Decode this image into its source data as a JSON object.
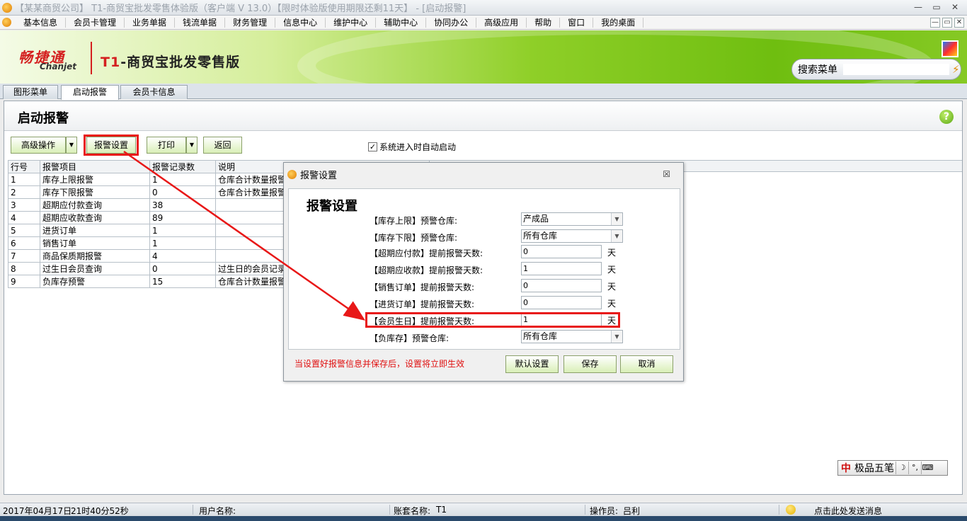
{
  "window": {
    "title": "【某某商贸公司】 T1-商贸宝批发零售体验版（客户端 V 13.0）【限时体验版使用期限还剩11天】 - [启动报警]",
    "controls": [
      "—",
      "▭",
      "✕"
    ]
  },
  "menu": {
    "items": [
      "基本信息",
      "会员卡管理",
      "业务单据",
      "钱流单据",
      "财务管理",
      "信息中心",
      "维护中心",
      "辅助中心",
      "协同办公",
      "高级应用",
      "帮助",
      "窗口",
      "我的桌面"
    ],
    "mdi_controls": [
      "—",
      "▭",
      "✕"
    ]
  },
  "banner": {
    "logo_cn": "畅捷通",
    "logo_en": "Chanjet",
    "product_t1": "T1",
    "product_name": "-商贸宝批发零售版",
    "search_label": "搜索菜单",
    "search_value": ""
  },
  "tabs": [
    "图形菜单",
    "启动报警",
    "会员卡信息"
  ],
  "page": {
    "title": "启动报警",
    "help": "?"
  },
  "toolbar": {
    "advanced": "高级操作",
    "alarm_settings": "报警设置",
    "print": "打印",
    "back": "返回",
    "auto_start_label": "系统进入时自动启动",
    "auto_start_checked": "✓"
  },
  "grid": {
    "headers": [
      "行号",
      "报警项目",
      "报警记录数",
      "说明"
    ],
    "rows": [
      [
        "1",
        "库存上限报警",
        "1",
        "仓库合计数量报警"
      ],
      [
        "2",
        "库存下限报警",
        "0",
        "仓库合计数量报警"
      ],
      [
        "3",
        "超期应付款查询",
        "38",
        ""
      ],
      [
        "4",
        "超期应收款查询",
        "89",
        ""
      ],
      [
        "5",
        "进货订单",
        "1",
        ""
      ],
      [
        "6",
        "销售订单",
        "1",
        ""
      ],
      [
        "7",
        "商品保质期报警",
        "4",
        ""
      ],
      [
        "8",
        "过生日会员查询",
        "0",
        "过生日的会员记录"
      ],
      [
        "9",
        "负库存预警",
        "15",
        "仓库合计数量报警"
      ]
    ]
  },
  "dialog": {
    "title": "报警设置",
    "close": "☒",
    "heading": "报警设置",
    "fields": [
      {
        "label": "【库存上限】预警仓库:",
        "value": "产成品",
        "unit": ""
      },
      {
        "label": "【库存下限】预警仓库:",
        "value": "所有仓库",
        "unit": ""
      },
      {
        "label": "【超期应付款】提前报警天数:",
        "value": "0",
        "unit": "天"
      },
      {
        "label": "【超期应收款】提前报警天数:",
        "value": "1",
        "unit": "天"
      },
      {
        "label": "【销售订单】提前报警天数:",
        "value": "0",
        "unit": "天"
      },
      {
        "label": "【进货订单】提前报警天数:",
        "value": "0",
        "unit": "天"
      },
      {
        "label": "【会员生日】提前报警天数:",
        "value": "1",
        "unit": "天"
      },
      {
        "label": "【负库存】预警仓库:",
        "value": "所有仓库",
        "unit": ""
      }
    ],
    "hint": "当设置好报警信息并保存后，设置将立即生效",
    "buttons": {
      "default": "默认设置",
      "save": "保存",
      "cancel": "取消"
    }
  },
  "ime": {
    "badge": "中",
    "name": "极品五笔",
    "icons": [
      "☽",
      "°,",
      "⌨"
    ]
  },
  "status": {
    "date": "2017年04月17日",
    "time": "21时40分52秒",
    "user_label": "用户名称:",
    "account_label": "账套名称:",
    "account_value": "T1",
    "operator_label": "操作员:",
    "operator_value": "吕利",
    "message": "点击此处发送消息"
  },
  "colors": {
    "highlight": "#e81818",
    "banner_green": "#6fbe10",
    "button_green": "#d9efb7"
  }
}
